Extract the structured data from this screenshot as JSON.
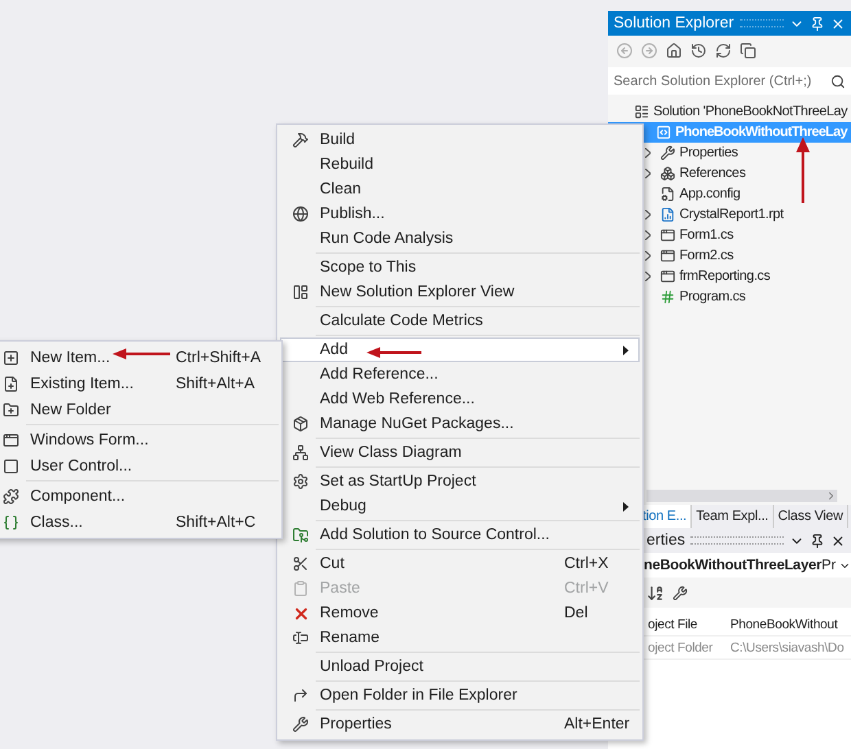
{
  "solution_explorer": {
    "title": "Solution Explorer",
    "search": {
      "placeholder": "Search Solution Explorer (Ctrl+;)"
    },
    "tree": [
      {
        "label": "Solution 'PhoneBookNotThreeLay",
        "kind": "solution",
        "selected": false,
        "expandable": false,
        "children": [
          {
            "label": "PhoneBookWithoutThreeLay",
            "kind": "project",
            "selected": true,
            "expandable": false,
            "children": [
              {
                "label": "Properties",
                "kind": "properties",
                "selected": false,
                "expandable": true
              },
              {
                "label": "References",
                "kind": "references",
                "selected": false,
                "expandable": true
              },
              {
                "label": "App.config",
                "kind": "config",
                "selected": false,
                "expandable": false
              },
              {
                "label": "CrystalReport1.rpt",
                "kind": "report",
                "selected": false,
                "expandable": true
              },
              {
                "label": "Form1.cs",
                "kind": "form",
                "selected": false,
                "expandable": true
              },
              {
                "label": "Form2.cs",
                "kind": "form",
                "selected": false,
                "expandable": true
              },
              {
                "label": "frmReporting.cs",
                "kind": "form",
                "selected": false,
                "expandable": true
              },
              {
                "label": "Program.cs",
                "kind": "code",
                "selected": false,
                "expandable": false
              }
            ]
          }
        ]
      }
    ],
    "tabs": [
      {
        "label": "tion E...",
        "selected": true
      },
      {
        "label": "Team Expl...",
        "selected": false
      },
      {
        "label": "Class View",
        "selected": false
      }
    ]
  },
  "properties": {
    "title": "erties",
    "object": "neBookWithoutThreeLayer",
    "object_type": "Pr",
    "rows": [
      {
        "name": "oject File",
        "value": "PhoneBookWithout",
        "disabled": false
      },
      {
        "name": "oject Folder",
        "value": "C:\\Users\\siavash\\Do",
        "disabled": true
      }
    ]
  },
  "context_menu": {
    "groups": [
      [
        {
          "label": "Build",
          "kind": "build",
          "selected": false,
          "disabled": false,
          "submenu": false
        },
        {
          "label": "Rebuild",
          "kind": "plain",
          "selected": false,
          "disabled": false,
          "submenu": false
        },
        {
          "label": "Clean",
          "kind": "plain",
          "selected": false,
          "disabled": false,
          "submenu": false
        },
        {
          "label": "Publish...",
          "kind": "publish",
          "selected": false,
          "disabled": false,
          "submenu": false
        },
        {
          "label": "Run Code Analysis",
          "kind": "plain",
          "selected": false,
          "disabled": false,
          "submenu": false
        }
      ],
      [
        {
          "label": "Scope to This",
          "kind": "plain",
          "selected": false,
          "disabled": false,
          "submenu": false
        },
        {
          "label": "New Solution Explorer View",
          "kind": "newview",
          "selected": false,
          "disabled": false,
          "submenu": false
        }
      ],
      [
        {
          "label": "Calculate Code Metrics",
          "kind": "plain",
          "selected": false,
          "disabled": false,
          "submenu": false
        }
      ],
      [
        {
          "label": "Add",
          "kind": "plain",
          "selected": true,
          "disabled": false,
          "submenu": true
        },
        {
          "label": "Add Reference...",
          "kind": "plain",
          "selected": false,
          "disabled": false,
          "submenu": false
        },
        {
          "label": "Add Web Reference...",
          "kind": "plain",
          "selected": false,
          "disabled": false,
          "submenu": false
        },
        {
          "label": "Manage NuGet Packages...",
          "kind": "package",
          "selected": false,
          "disabled": false,
          "submenu": false
        }
      ],
      [
        {
          "label": "View Class Diagram",
          "kind": "diagram",
          "selected": false,
          "disabled": false,
          "submenu": false
        }
      ],
      [
        {
          "label": "Set as StartUp Project",
          "kind": "startup",
          "selected": false,
          "disabled": false,
          "submenu": false
        },
        {
          "label": "Debug",
          "kind": "plain",
          "selected": false,
          "disabled": false,
          "submenu": true
        }
      ],
      [
        {
          "label": "Add Solution to Source Control...",
          "kind": "sourcecontrol",
          "selected": false,
          "disabled": false,
          "submenu": false
        }
      ],
      [
        {
          "label": "Cut",
          "kind": "cut",
          "shortcut": "Ctrl+X",
          "selected": false,
          "disabled": false,
          "submenu": false
        },
        {
          "label": "Paste",
          "kind": "paste",
          "shortcut": "Ctrl+V",
          "selected": false,
          "disabled": true,
          "submenu": false
        },
        {
          "label": "Remove",
          "kind": "remove",
          "shortcut": "Del",
          "selected": false,
          "disabled": false,
          "submenu": false
        },
        {
          "label": "Rename",
          "kind": "rename",
          "selected": false,
          "disabled": false,
          "submenu": false
        }
      ],
      [
        {
          "label": "Unload Project",
          "kind": "plain",
          "selected": false,
          "disabled": false,
          "submenu": false
        }
      ],
      [
        {
          "label": "Open Folder in File Explorer",
          "kind": "openfolder",
          "selected": false,
          "disabled": false,
          "submenu": false
        }
      ],
      [
        {
          "label": "Properties",
          "kind": "properties",
          "shortcut": "Alt+Enter",
          "selected": false,
          "disabled": false,
          "submenu": false
        }
      ]
    ]
  },
  "add_submenu": {
    "groups": [
      [
        {
          "label": "New Item...",
          "kind": "newitem",
          "shortcut": "Ctrl+Shift+A"
        },
        {
          "label": "Existing Item...",
          "kind": "existing",
          "shortcut": "Shift+Alt+A"
        },
        {
          "label": "New Folder",
          "kind": "folder"
        }
      ],
      [
        {
          "label": "Windows Form...",
          "kind": "form"
        },
        {
          "label": "User Control...",
          "kind": "control"
        }
      ],
      [
        {
          "label": "Component...",
          "kind": "component"
        },
        {
          "label": "Class...",
          "kind": "class",
          "shortcut": "Shift+Alt+C"
        }
      ]
    ]
  }
}
